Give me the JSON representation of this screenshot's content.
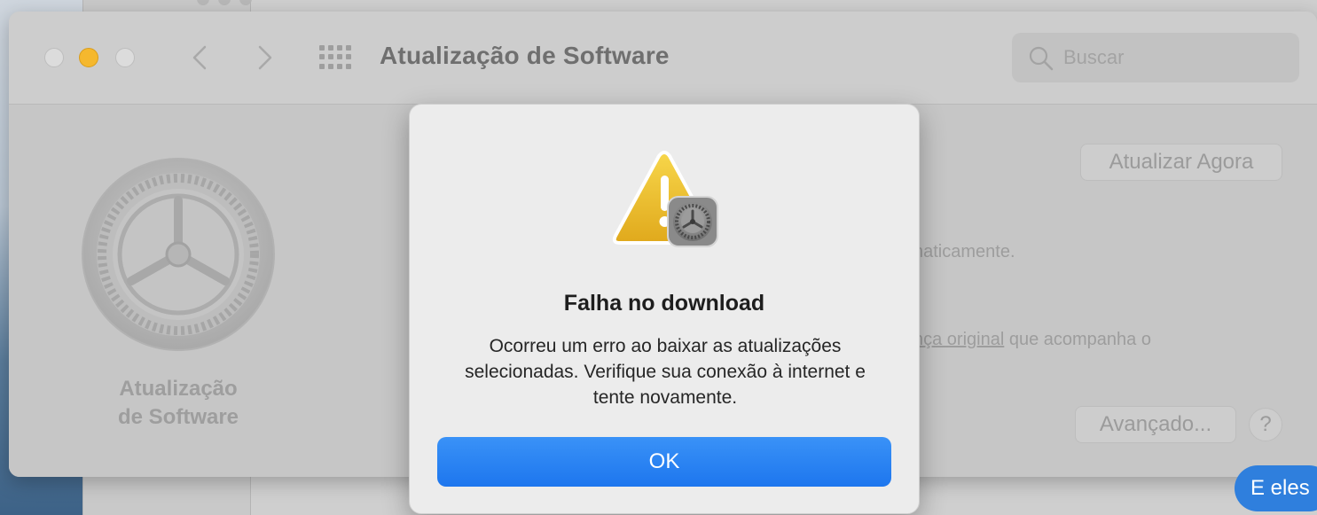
{
  "window": {
    "title": "Atualização de Software",
    "search_placeholder": "Buscar"
  },
  "sidebar": {
    "label_line1": "Atualização",
    "label_line2": "de Software"
  },
  "main": {
    "update_now_label": "Atualizar Agora",
    "auto_text_fragment": "naticamente.",
    "license_link_fragment": "nça original",
    "license_text_rest": " que acompanha o",
    "advanced_label": "Avançado...",
    "help_label": "?"
  },
  "dialog": {
    "title": "Falha no download",
    "message": "Ocorreu um erro ao baixar as atualizações selecionadas. Verifique sua conexão à internet e tente novamente.",
    "ok_label": "OK"
  },
  "chat_bubble": {
    "text": "E eles"
  },
  "colors": {
    "accent": "#1d76ee",
    "minimize": "#f5b82e"
  }
}
